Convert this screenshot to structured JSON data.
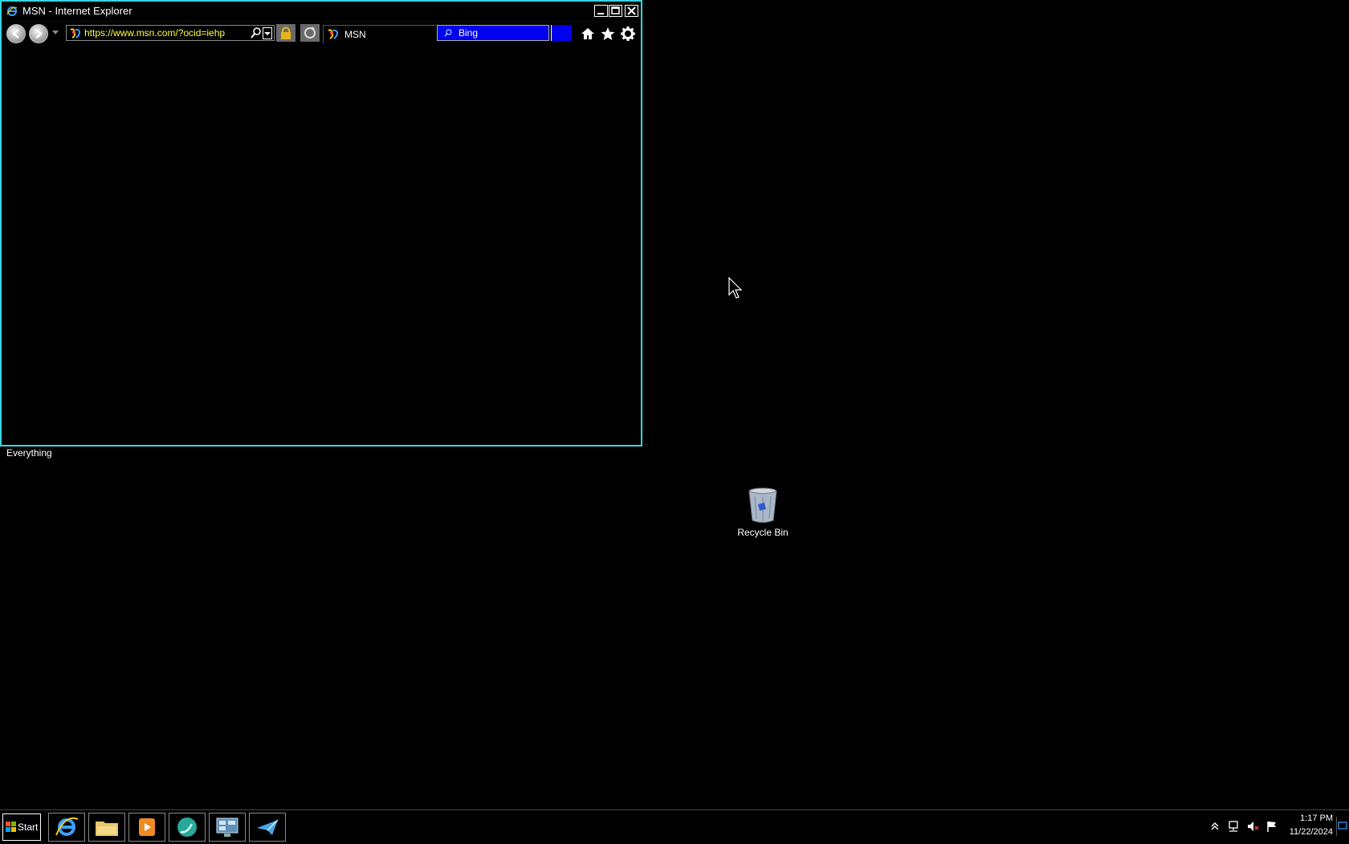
{
  "window": {
    "title": "MSN - Internet Explorer",
    "address": "https://www.msn.com/?ocid=iehp",
    "tab_title": "MSN",
    "search_provider": "Bing",
    "accent_color": "#33d6e0",
    "search_bg_color": "#0000ee",
    "address_text_color": "#ffff3a"
  },
  "status_label": "Everything",
  "desktop": {
    "recycle_bin_label": "Recycle Bin"
  },
  "taskbar": {
    "start_label": "Start",
    "pinned": [
      {
        "name": "internet-explorer"
      },
      {
        "name": "file-explorer"
      },
      {
        "name": "media-player"
      },
      {
        "name": "chat-app"
      },
      {
        "name": "control-panel"
      },
      {
        "name": "send-app"
      }
    ],
    "clock_time": "1:17 PM",
    "clock_date": "11/22/2024"
  }
}
